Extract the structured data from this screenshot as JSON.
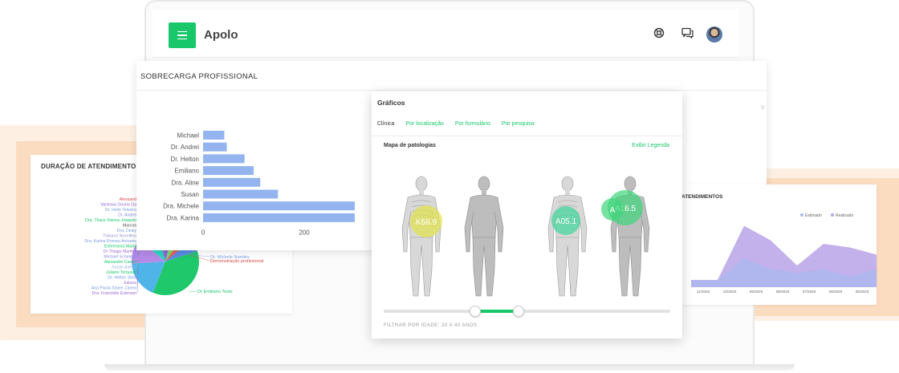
{
  "app": {
    "title": "Apolo"
  },
  "colors": {
    "brand": "#19c76b",
    "bar": "#94b4f0",
    "area_estimado": "#a9b8ef",
    "area_realizado": "#b9a3e8"
  },
  "icons": {
    "menu": "menu-icon",
    "support": "lifebuoy-icon",
    "chat": "chat-icon",
    "avatar": "avatar"
  },
  "duracao": {
    "title": "DURAÇÃO DE ATENDIMENTOS",
    "chart_data": {
      "type": "pie",
      "labels_left": [
        {
          "text": "Alessand",
          "color": "#d84a4a"
        },
        {
          "text": "Vanessa Osorio Ga",
          "color": "#8a6ad6"
        },
        {
          "text": "Dr. Helio Teixeira",
          "color": "#7a9be0"
        },
        {
          "text": "Dr. Andrei",
          "color": "#8a8ae0"
        },
        {
          "text": "Dra. Thays Vianna Joaquim",
          "color": "#19c76b"
        },
        {
          "text": "Marcos",
          "color": "#555555"
        },
        {
          "text": "Dra. Deisy",
          "color": "#7a9be0"
        },
        {
          "text": "Fabiano Novellino",
          "color": "#9a9ad0"
        },
        {
          "text": "Dra. Karina Romao Antunes",
          "color": "#7a9be0"
        },
        {
          "text": "Enfermeira Marta",
          "color": "#19c76b"
        },
        {
          "text": "Dr Thiago Martins",
          "color": "#a06ad6"
        },
        {
          "text": "Michael Schenkel",
          "color": "#8a8ae0"
        },
        {
          "text": "Alexandre Castro",
          "color": "#19c76b"
        },
        {
          "text": "Susan Aaerts",
          "color": "#9ab0e0"
        },
        {
          "text": "Juliano Torquato",
          "color": "#19c76b"
        },
        {
          "text": "Dr. Helton Silva",
          "color": "#7a9be0"
        },
        {
          "text": "Juliana",
          "color": "#a06ad6"
        },
        {
          "text": "Ana Paula Xavier Zanea",
          "color": "#7a9be0"
        },
        {
          "text": "Dra. Francielle Estevam",
          "color": "#a06ad6"
        }
      ],
      "labels_right": [
        {
          "text": "Dr. Michele Nandes",
          "color": "#7a9be0"
        },
        {
          "text": "Demonstração profissional",
          "color": "#d84a4a"
        },
        {
          "text": "Dr Emiliano Teste",
          "color": "#19c76b"
        }
      ],
      "slices": [
        {
          "color": "#1ec86b",
          "value": 36
        },
        {
          "color": "#4fb4e8",
          "value": 18
        },
        {
          "color": "#b48ae6",
          "value": 12
        },
        {
          "color": "#2fd4c2",
          "value": 10
        },
        {
          "color": "#8a6ad6",
          "value": 8
        },
        {
          "color": "#7fd36a",
          "value": 6
        },
        {
          "color": "#e45a5a",
          "value": 4
        },
        {
          "color": "#5b8be0",
          "value": 6
        }
      ]
    }
  },
  "sobrecarga": {
    "title": "SOBRECARGA PROFISSIONAL",
    "chart_data": {
      "type": "bar",
      "orientation": "horizontal",
      "categories": [
        "Michael",
        "Dr. Andrei",
        "Dr. Helton",
        "Emiliano",
        "Dra. Aline",
        "Susan",
        "Dra. Michele",
        "Dra. Karina"
      ],
      "values": [
        42,
        47,
        82,
        100,
        113,
        148,
        300,
        300
      ],
      "xlim": [
        0,
        300
      ],
      "xticks": [
        "0",
        "200"
      ]
    }
  },
  "atendimentos": {
    "title": "ATENDIMENTOS",
    "chart_data": {
      "type": "area",
      "categories": [
        "11/2020",
        "10/2020",
        "09/2020",
        "08/2020",
        "07/2020",
        "06/2020",
        "05/2020",
        "04/2020"
      ],
      "series": [
        {
          "name": "Estimado",
          "values": [
            2,
            2,
            8,
            5,
            4,
            5,
            3,
            5
          ]
        },
        {
          "name": "Realizado",
          "values": [
            2,
            2,
            17,
            13,
            6,
            12,
            11,
            9
          ]
        }
      ],
      "ylim": [
        0,
        20
      ]
    }
  },
  "graficos": {
    "title": "Gráficos",
    "tabs": [
      {
        "label": "Clínica",
        "active": true
      },
      {
        "label": "Por localização",
        "active": false
      },
      {
        "label": "Por formulário",
        "active": false
      },
      {
        "label": "Por pesquisa",
        "active": false
      }
    ],
    "mapa_title": "Mapa de patologias",
    "legend_link": "Exibir Legenda",
    "hotspots": [
      {
        "label": "K58.9",
        "color": "#e3e44a"
      },
      {
        "label": "A05.1",
        "color": "#3ed69a"
      },
      {
        "label": "A16.5",
        "color": "#3ed67a"
      },
      {
        "label": "A",
        "color": "#3ed67a"
      }
    ],
    "age_filter": {
      "label": "FILTRAR POR IDADE: 20 A 40 ANOS",
      "min": 20,
      "max": 40,
      "range_min": 0,
      "range_max": 100
    }
  }
}
